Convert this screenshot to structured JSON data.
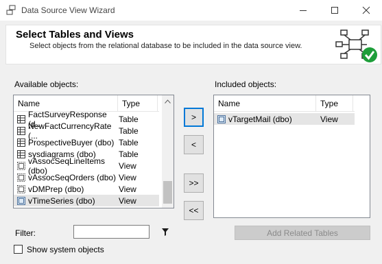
{
  "window": {
    "title": "Data Source View Wizard"
  },
  "header": {
    "title": "Select Tables and Views",
    "subtitle": "Select objects from the relational database to be included in the data source view."
  },
  "available": {
    "label": "Available objects:",
    "columns": [
      "Name",
      "Type"
    ],
    "rows": [
      {
        "name": "FactSurveyResponse (d...",
        "type": "Table",
        "icon": "table-icon"
      },
      {
        "name": "NewFactCurrencyRate (...",
        "type": "Table",
        "icon": "table-icon"
      },
      {
        "name": "ProspectiveBuyer (dbo)",
        "type": "Table",
        "icon": "table-icon"
      },
      {
        "name": "sysdiagrams (dbo)",
        "type": "Table",
        "icon": "table-icon"
      },
      {
        "name": "vAssocSeqLineItems (dbo)",
        "type": "View",
        "icon": "view-icon"
      },
      {
        "name": "vAssocSeqOrders (dbo)",
        "type": "View",
        "icon": "view-icon"
      },
      {
        "name": "vDMPrep (dbo)",
        "type": "View",
        "icon": "view-icon"
      },
      {
        "name": "vTimeSeries (dbo)",
        "type": "View",
        "icon": "view-icon",
        "selected": true
      }
    ],
    "scroll_position": 1.0
  },
  "included": {
    "label": "Included objects:",
    "columns": [
      "Name",
      "Type"
    ],
    "rows": [
      {
        "name": "vTargetMail (dbo)",
        "type": "View",
        "icon": "view-icon",
        "selected": true
      }
    ]
  },
  "buttons": {
    "add": ">",
    "remove": "<",
    "add_all": ">>",
    "remove_all": "<<",
    "add_related": "Add Related Tables"
  },
  "filter": {
    "label": "Filter:",
    "value": ""
  },
  "show_system": {
    "label": "Show system objects",
    "checked": false
  },
  "colors": {
    "accent": "#0078d7",
    "selected_row": "#e5e5e5",
    "check_green": "#1e9e3a"
  }
}
